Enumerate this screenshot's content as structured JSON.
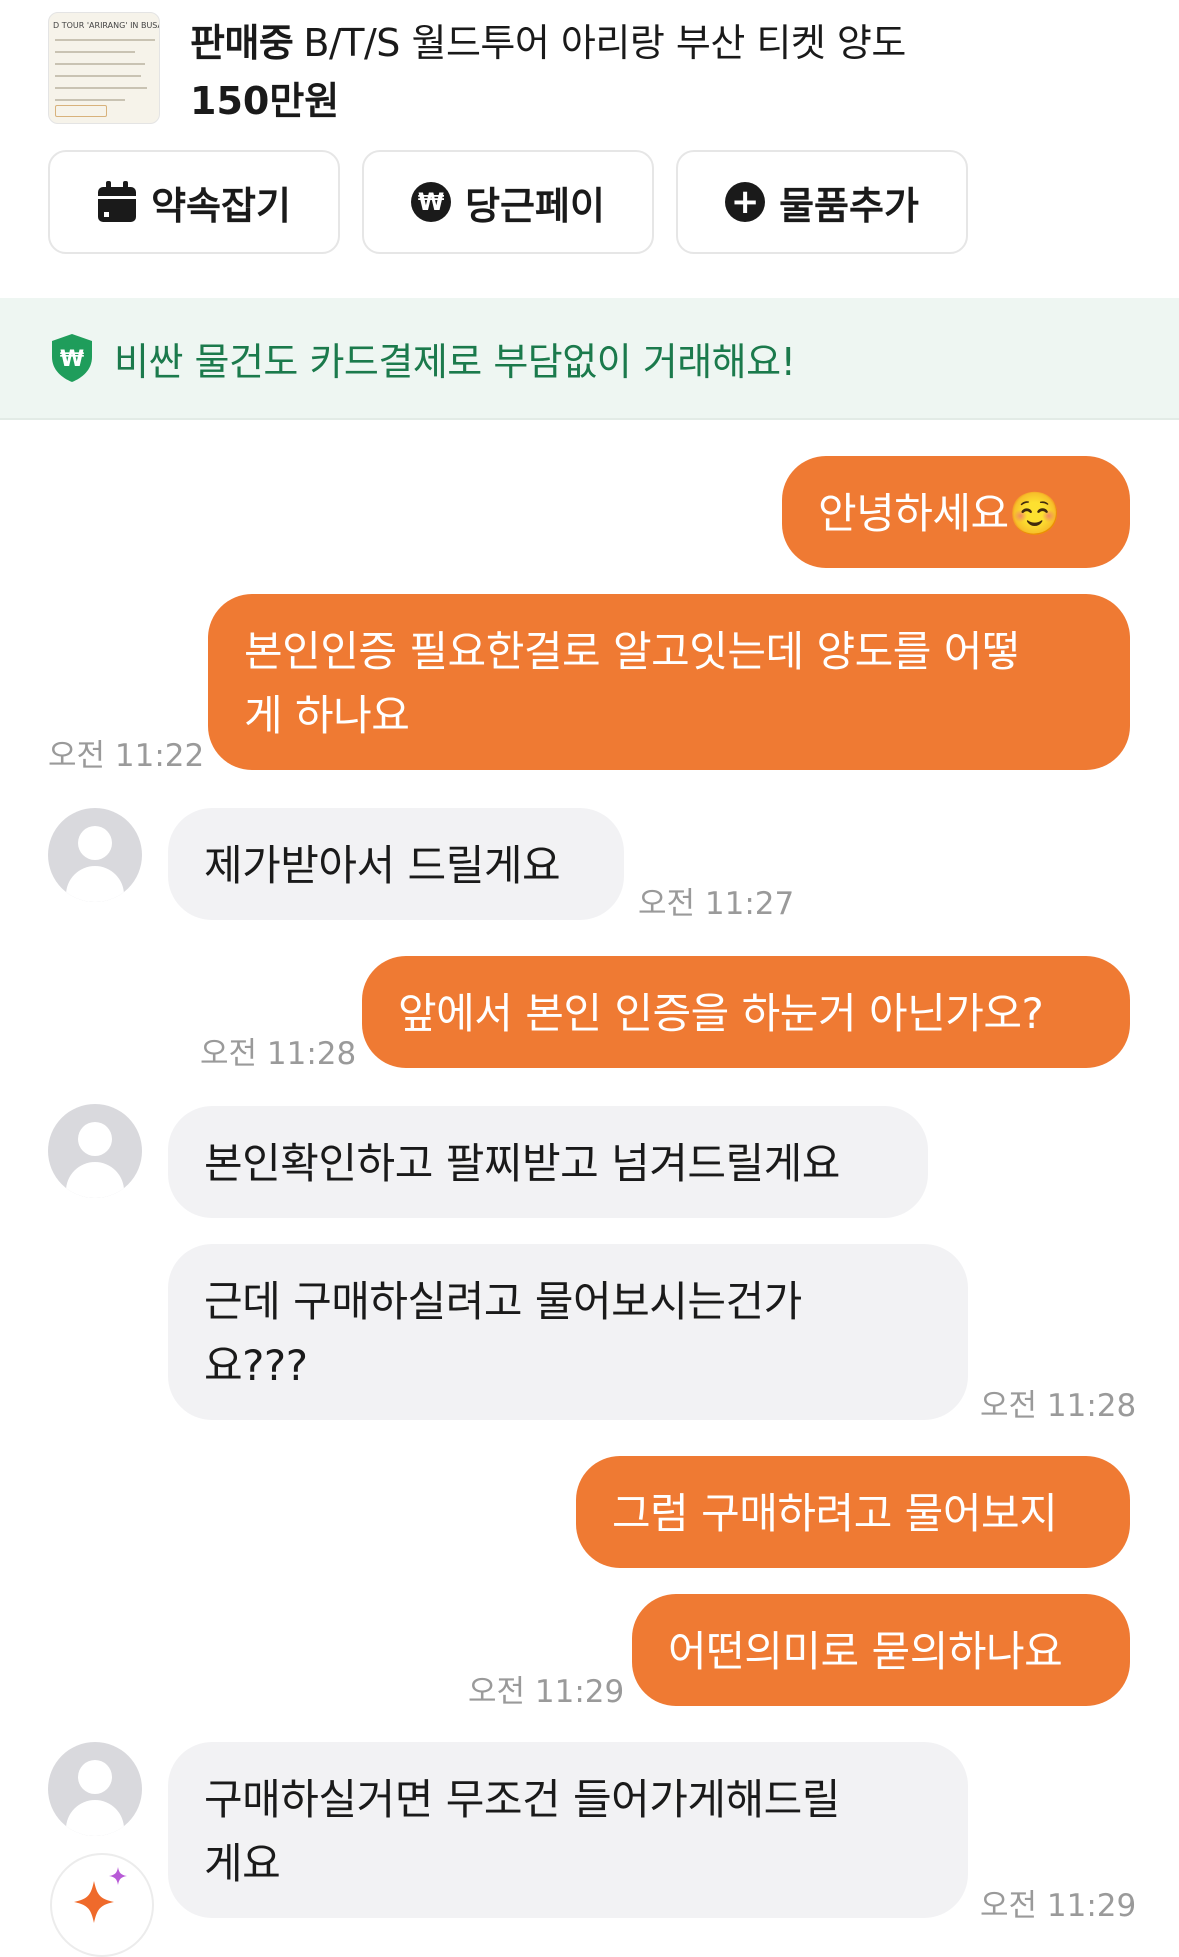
{
  "product": {
    "thumbnail_heading": "D TOUR 'ARIRANG' IN BUSA",
    "status": "판매중",
    "title": "B/T/S 월드투어 아리랑 부산 티켓 양도",
    "price": "150만원"
  },
  "actions": [
    {
      "label": "약속잡기",
      "icon": "calendar-icon"
    },
    {
      "label": "당근페이",
      "icon": "won-pay-icon"
    },
    {
      "label": "물품추가",
      "icon": "plus-circle-icon"
    }
  ],
  "banner": {
    "icon": "shield-won-icon",
    "text": "비싼 물건도 카드결제로 부담없이 거래해요!"
  },
  "messages": [
    {
      "id": "m1",
      "side": "out",
      "text": "안녕하세요",
      "emoji": "☺️"
    },
    {
      "id": "m2",
      "side": "out",
      "lines": [
        "본인인증 필요한걸로 알고잇는데 양도를 어떻",
        "게 하나요"
      ],
      "time": "오전 11:22"
    },
    {
      "id": "m3",
      "side": "in",
      "text": "제가받아서 드릴게요",
      "time": "오전 11:27"
    },
    {
      "id": "m4",
      "side": "out",
      "text": "앞에서 본인 인증을 하눈거 아닌가오?",
      "time": "오전 11:28"
    },
    {
      "id": "m5",
      "side": "in",
      "text": "본인확인하고 팔찌받고 넘겨드릴게요"
    },
    {
      "id": "m6",
      "side": "in",
      "lines": [
        "근데 구매하실려고 물어보시는건가",
        "요???"
      ],
      "time": "오전 11:28"
    },
    {
      "id": "m7",
      "side": "out",
      "text": "그럼 구매하려고 물어보지"
    },
    {
      "id": "m8",
      "side": "out",
      "text": "어떤의미로 묻의하나요",
      "time": "오전 11:29"
    },
    {
      "id": "m9",
      "side": "in",
      "lines": [
        "구매하실거면 무조건 들어가게해드릴",
        "게요"
      ],
      "time": "오전 11:29"
    }
  ],
  "colors": {
    "accent": "#ef7a33",
    "banner_bg": "#eef6f2",
    "banner_text": "#1b7a4c",
    "incoming_bubble": "#f2f2f4"
  },
  "fab_icon": "sparkle-icon"
}
